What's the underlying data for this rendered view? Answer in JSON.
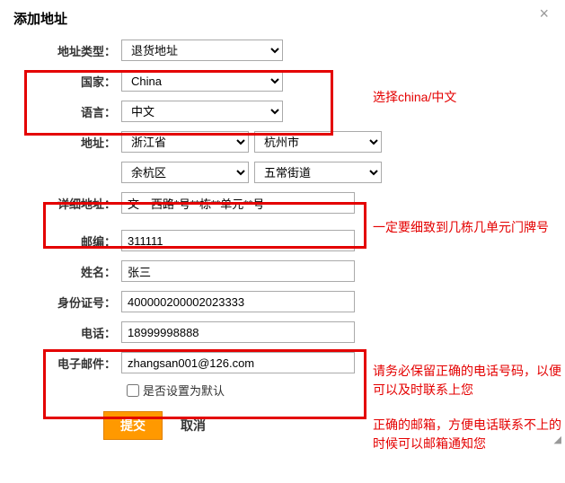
{
  "title": "添加地址",
  "close_symbol": "×",
  "labels": {
    "address_type": "地址类型：",
    "country": "国家：",
    "language": "语言：",
    "address": "地址：",
    "detail_address": "详细地址：",
    "postcode": "邮编：",
    "name": "姓名：",
    "id_number": "身份证号：",
    "phone": "电话：",
    "email": "电子邮件："
  },
  "values": {
    "address_type": "退货地址",
    "country": "China",
    "language": "中文",
    "province": "浙江省",
    "city": "杭州市",
    "district": "余杭区",
    "street": "五常街道",
    "detail_address": "文一西路*号**栋**单元**号",
    "postcode": "311111",
    "name": "张三",
    "id_number": "400000200002023333",
    "phone": "18999998888",
    "email": "zhangsan001@126.com"
  },
  "checkbox": {
    "set_default_label": "是否设置为默认"
  },
  "buttons": {
    "submit": "提交",
    "cancel": "取消"
  },
  "hints": {
    "hint1": "选择china/中文",
    "hint2": "一定要细致到几栋几单元门牌号",
    "hint3": "请务必保留正确的电话号码，以便可以及时联系上您",
    "hint4": "正确的邮箱，方便电话联系不上的时候可以邮箱通知您"
  }
}
